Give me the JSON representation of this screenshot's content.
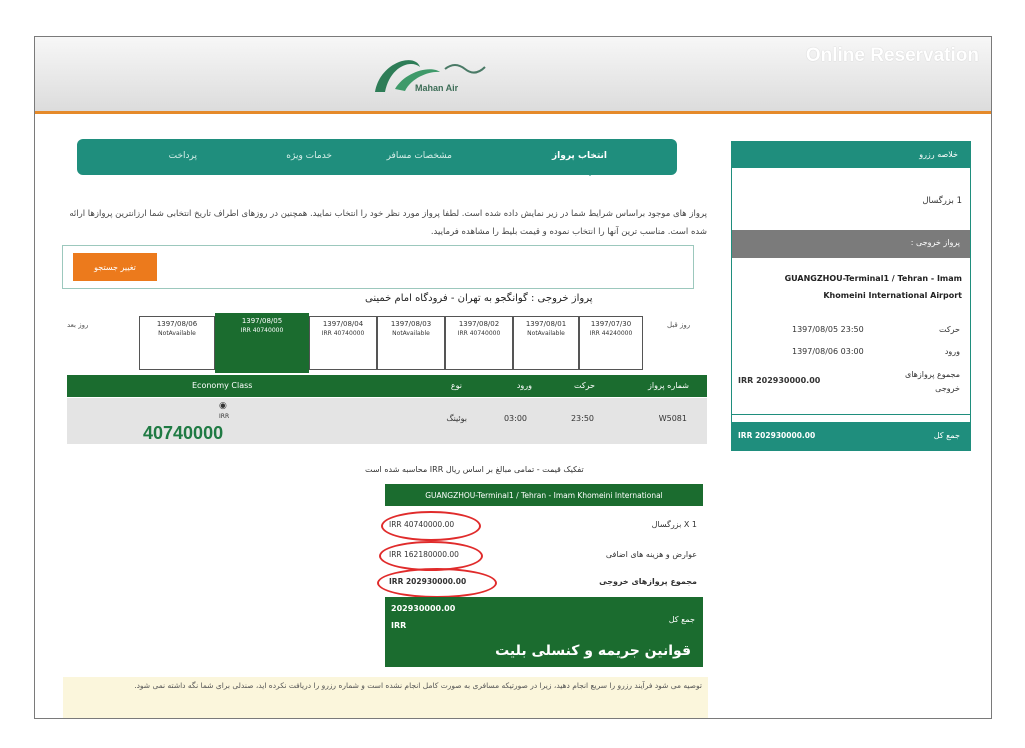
{
  "header": {
    "brand": "Online Reservation",
    "logo_text": "Mahan Air"
  },
  "steps": [
    {
      "label": "انتخاب پرواز",
      "active": true
    },
    {
      "label": "مشخصات مسافر",
      "active": false
    },
    {
      "label": "خدمات ویژه",
      "active": false
    },
    {
      "label": "پرداخت",
      "active": false
    }
  ],
  "intro": "پرواز های موجود براساس شرایط شما در زیر نمایش داده شده است. لطفا پرواز مورد نظر خود را انتخاب نمایید. همچنین در روزهای اطراف تاریخ انتخابی شما ارزانترین پروازها ارائه شده است. مناسب ترین آنها را انتخاب نموده و قیمت بلیط را مشاهده فرمایید.",
  "change_search": "تغییر جستجو",
  "route_heading": "پرواز خروجی : گوانگجو به تهران - فرودگاه امام خمینی",
  "dates": {
    "prev_label": "روز قبل",
    "next_label": "روز بعد",
    "cells": [
      {
        "date": "1397/07/30",
        "price": "IRR 44240000"
      },
      {
        "date": "1397/08/01",
        "price": "NotAvailable"
      },
      {
        "date": "1397/08/02",
        "price": "IRR 40740000"
      },
      {
        "date": "1397/08/03",
        "price": "NotAvailable"
      },
      {
        "date": "1397/08/04",
        "price": "IRR 40740000"
      },
      {
        "date": "1397/08/05",
        "price": "IRR 40740000"
      },
      {
        "date": "1397/08/06",
        "price": "NotAvailable"
      }
    ]
  },
  "table": {
    "headers": {
      "flight_no": "شماره پرواز",
      "departure": "حرکت",
      "arrival": "ورود",
      "aircraft": "نوع",
      "class": "Economy Class"
    },
    "row": {
      "flight_no": "W5081",
      "departure": "23:50",
      "arrival": "03:00",
      "aircraft": "بوئینگ"
    },
    "price_small": "IRR",
    "price_big": "40740000"
  },
  "breakdown": {
    "title": "تفکیک قیمت - تمامی مبالغ بر اساس ریال IRR محاسبه شده است",
    "route": "GUANGZHOU-Terminal1 / Tehran - Imam Khomeini International",
    "rows": [
      {
        "label": "1 X بزرگسال",
        "value": "IRR 40740000.00"
      },
      {
        "label": "عوارض و هزینه های اضافی",
        "value": "IRR 162180000.00"
      },
      {
        "label": "مجموع پروازهای خروجی",
        "value": "IRR 202930000.00"
      }
    ]
  },
  "total": {
    "amount": "202930000.00",
    "currency": "IRR",
    "label": "جمع کل",
    "rules": "قوانین جریمه و کنسلی بلیت"
  },
  "note": "توصیه می شود فرآیند رزرو را سریع انجام دهید، زیرا در صورتیکه مسافری به صورت کامل انجام نشده است و شماره رزرو را دریافت نکرده اید، صندلی برای شما نگه داشته نمی شود.",
  "summary": {
    "title": "خلاصه رزرو",
    "adult": "1 بزرگسال",
    "subheader": "پرواز خروجی :",
    "route": "GUANGZHOU-Terminal1 / Tehran - Imam Khomeini International Airport",
    "departure_label": "حرکت",
    "departure_value": "1397/08/05 23:50",
    "arrival_label": "ورود",
    "arrival_value": "1397/08/06 03:00",
    "subtotal_label": "مجموع پروازهای خروجی",
    "subtotal_value": "IRR 202930000.00",
    "total_label": "جمع کل",
    "total_value": "IRR 202930000.00"
  },
  "colors": {
    "teal": "#1f8e7d",
    "dark_green": "#1b6c2f",
    "orange": "#ec7a1c",
    "highlight_red": "#e02b2b"
  }
}
